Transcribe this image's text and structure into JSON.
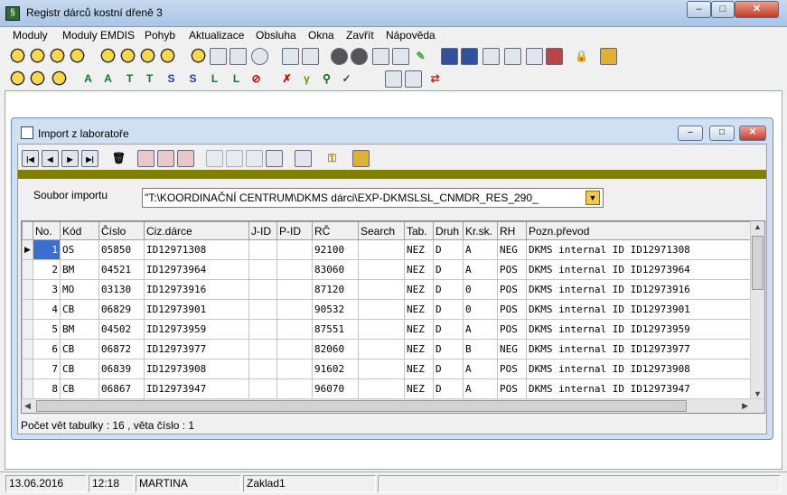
{
  "app": {
    "title": "Registr dárců kostní dřeně 3",
    "menu": [
      "Moduly",
      "Moduly EMDIS",
      "Pohyb",
      "Aktualizace",
      "Obsluha",
      "Okna",
      "Zavřít",
      "Nápověda"
    ]
  },
  "toolbar2_letters": [
    "A",
    "A",
    "T",
    "T",
    "S",
    "S",
    "L",
    "L"
  ],
  "import_window": {
    "title": "Import z laboratoře",
    "source_label": "Soubor importu",
    "source_value": "\"T:\\KOORDINAČNÍ CENTRUM\\DKMS dárci\\EXP-DKMSLSL_CNMDR_RES_290_",
    "columns": [
      "No.",
      "Kód",
      "Číslo",
      "Ciz.dárce",
      "J-ID",
      "P-ID",
      "RČ",
      "Search",
      "Tab.",
      "Druh",
      "Kr.sk.",
      "RH",
      "Pozn.převod"
    ],
    "rows": [
      [
        "1",
        "OS",
        "05850",
        "ID12971308",
        "",
        "",
        "92100",
        "",
        "NEZ",
        "D",
        "A",
        "NEG",
        "DKMS internal ID ID12971308"
      ],
      [
        "2",
        "BM",
        "04521",
        "ID12973964",
        "",
        "",
        "83060",
        "",
        "NEZ",
        "D",
        "A",
        "POS",
        "DKMS internal ID ID12973964"
      ],
      [
        "3",
        "MO",
        "03130",
        "ID12973916",
        "",
        "",
        "87120",
        "",
        "NEZ",
        "D",
        "0",
        "POS",
        "DKMS internal ID ID12973916"
      ],
      [
        "4",
        "CB",
        "06829",
        "ID12973901",
        "",
        "",
        "90532",
        "",
        "NEZ",
        "D",
        "0",
        "POS",
        "DKMS internal ID ID12973901"
      ],
      [
        "5",
        "BM",
        "04502",
        "ID12973959",
        "",
        "",
        "87551",
        "",
        "NEZ",
        "D",
        "A",
        "POS",
        "DKMS internal ID ID12973959"
      ],
      [
        "6",
        "CB",
        "06872",
        "ID12973977",
        "",
        "",
        "82060",
        "",
        "NEZ",
        "D",
        "B",
        "NEG",
        "DKMS internal ID ID12973977"
      ],
      [
        "7",
        "CB",
        "06839",
        "ID12973908",
        "",
        "",
        "91602",
        "",
        "NEZ",
        "D",
        "A",
        "POS",
        "DKMS internal ID ID12973908"
      ],
      [
        "8",
        "CB",
        "06867",
        "ID12973947",
        "",
        "",
        "96070",
        "",
        "NEZ",
        "D",
        "A",
        "POS",
        "DKMS internal ID ID12973947"
      ]
    ],
    "record_count": "Počet vět tabulky : 16 , věta číslo : 1"
  },
  "status": {
    "date": "13.06.2016",
    "time": "12:18",
    "user": "MARTINA",
    "db": "Zaklad1"
  }
}
